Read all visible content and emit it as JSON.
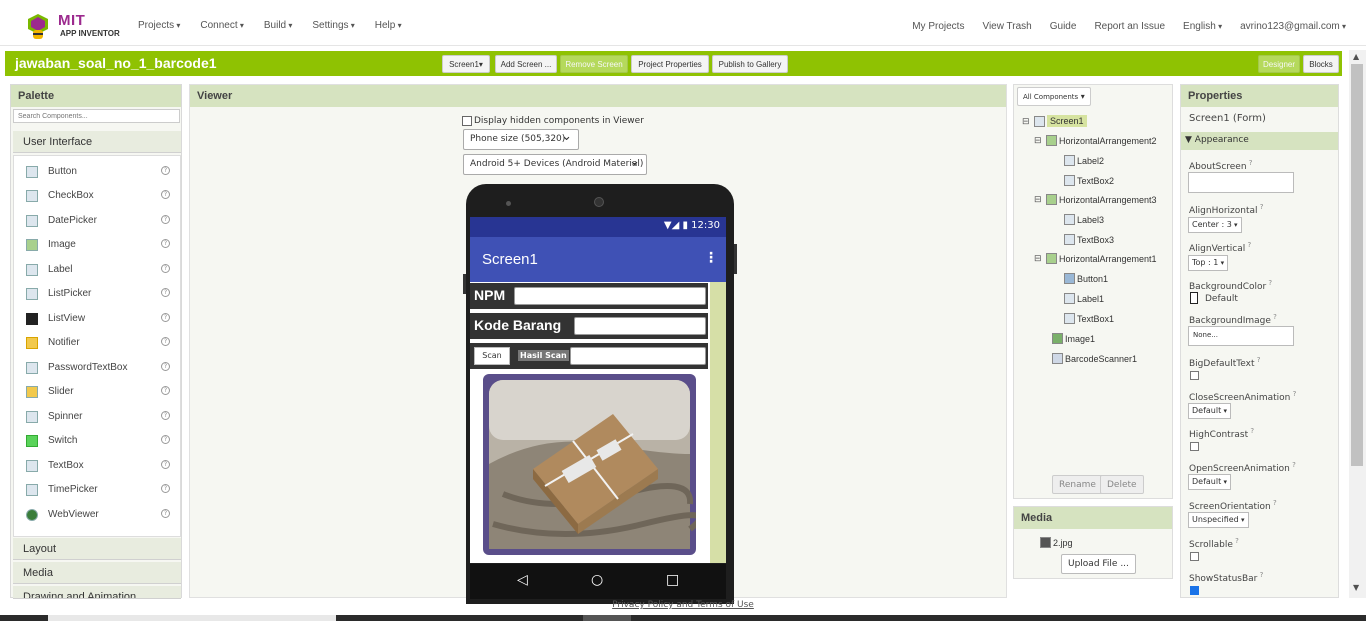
{
  "app": {
    "logo_line1": "MIT",
    "logo_line2": "APP INVENTOR"
  },
  "nav": {
    "left": [
      "Projects",
      "Connect",
      "Build",
      "Settings",
      "Help"
    ],
    "right": [
      "My Projects",
      "View Trash",
      "Guide",
      "Report an Issue",
      "English",
      "avrino123@gmail.com"
    ]
  },
  "project": {
    "name": "jawaban_soal_no_1_barcode1",
    "screen_select": "Screen1",
    "add_screen": "Add Screen ...",
    "remove_screen": "Remove Screen",
    "project_properties": "Project Properties",
    "publish": "Publish to Gallery",
    "designer": "Designer",
    "blocks": "Blocks"
  },
  "palette": {
    "title": "Palette",
    "search_placeholder": "Search Components...",
    "category": "User Interface",
    "components": [
      "Button",
      "CheckBox",
      "DatePicker",
      "Image",
      "Label",
      "ListPicker",
      "ListView",
      "Notifier",
      "PasswordTextBox",
      "Slider",
      "Spinner",
      "Switch",
      "TextBox",
      "TimePicker",
      "WebViewer"
    ],
    "other_categories": [
      "Layout",
      "Media",
      "Drawing and Animation"
    ]
  },
  "viewer": {
    "title": "Viewer",
    "hidden_checkbox_label": "Display hidden components in Viewer",
    "phone_size": "Phone size (505,320)",
    "device_theme": "Android 5+ Devices (Android Material)",
    "phone": {
      "time": "12:30",
      "screen_title": "Screen1",
      "label_npm": "NPM",
      "label_kode": "Kode Barang",
      "scan_button": "Scan",
      "hasil_scan": "Hasil Scan"
    }
  },
  "components": {
    "dropdown": "All Components",
    "tree": [
      {
        "name": "Screen1",
        "level": 0,
        "toggle": "⊟",
        "selected": true
      },
      {
        "name": "HorizontalArrangement2",
        "level": 1,
        "toggle": "⊟"
      },
      {
        "name": "Label2",
        "level": 2
      },
      {
        "name": "TextBox2",
        "level": 2
      },
      {
        "name": "HorizontalArrangement3",
        "level": 1,
        "toggle": "⊟"
      },
      {
        "name": "Label3",
        "level": 2
      },
      {
        "name": "TextBox3",
        "level": 2
      },
      {
        "name": "HorizontalArrangement1",
        "level": 1,
        "toggle": "⊟"
      },
      {
        "name": "Button1",
        "level": 2
      },
      {
        "name": "Label1",
        "level": 2
      },
      {
        "name": "TextBox1",
        "level": 2
      },
      {
        "name": "Image1",
        "level": 1
      },
      {
        "name": "BarcodeScanner1",
        "level": 1
      }
    ],
    "rename": "Rename",
    "delete": "Delete"
  },
  "media": {
    "title": "Media",
    "file": "2.jpg",
    "upload": "Upload File ..."
  },
  "properties": {
    "title": "Properties",
    "component": "Screen1 (Form)",
    "section": "Appearance",
    "about_screen": "AboutScreen",
    "align_horizontal": "AlignHorizontal",
    "align_horizontal_value": "Center : 3",
    "align_vertical": "AlignVertical",
    "align_vertical_value": "Top : 1",
    "background_color": "BackgroundColor",
    "background_color_value": "Default",
    "background_image": "BackgroundImage",
    "background_image_value": "None...",
    "big_default_text": "BigDefaultText",
    "close_anim": "CloseScreenAnimation",
    "close_anim_value": "Default",
    "high_contrast": "HighContrast",
    "open_anim": "OpenScreenAnimation",
    "open_anim_value": "Default",
    "orientation": "ScreenOrientation",
    "orientation_value": "Unspecified",
    "scrollable": "Scrollable",
    "show_status_bar": "ShowStatusBar"
  },
  "footer": "Privacy Policy and Terms of Use",
  "colors": {
    "brand_green": "#8fc202",
    "app_bar": "#3f51b5",
    "status_bar": "#283593"
  }
}
